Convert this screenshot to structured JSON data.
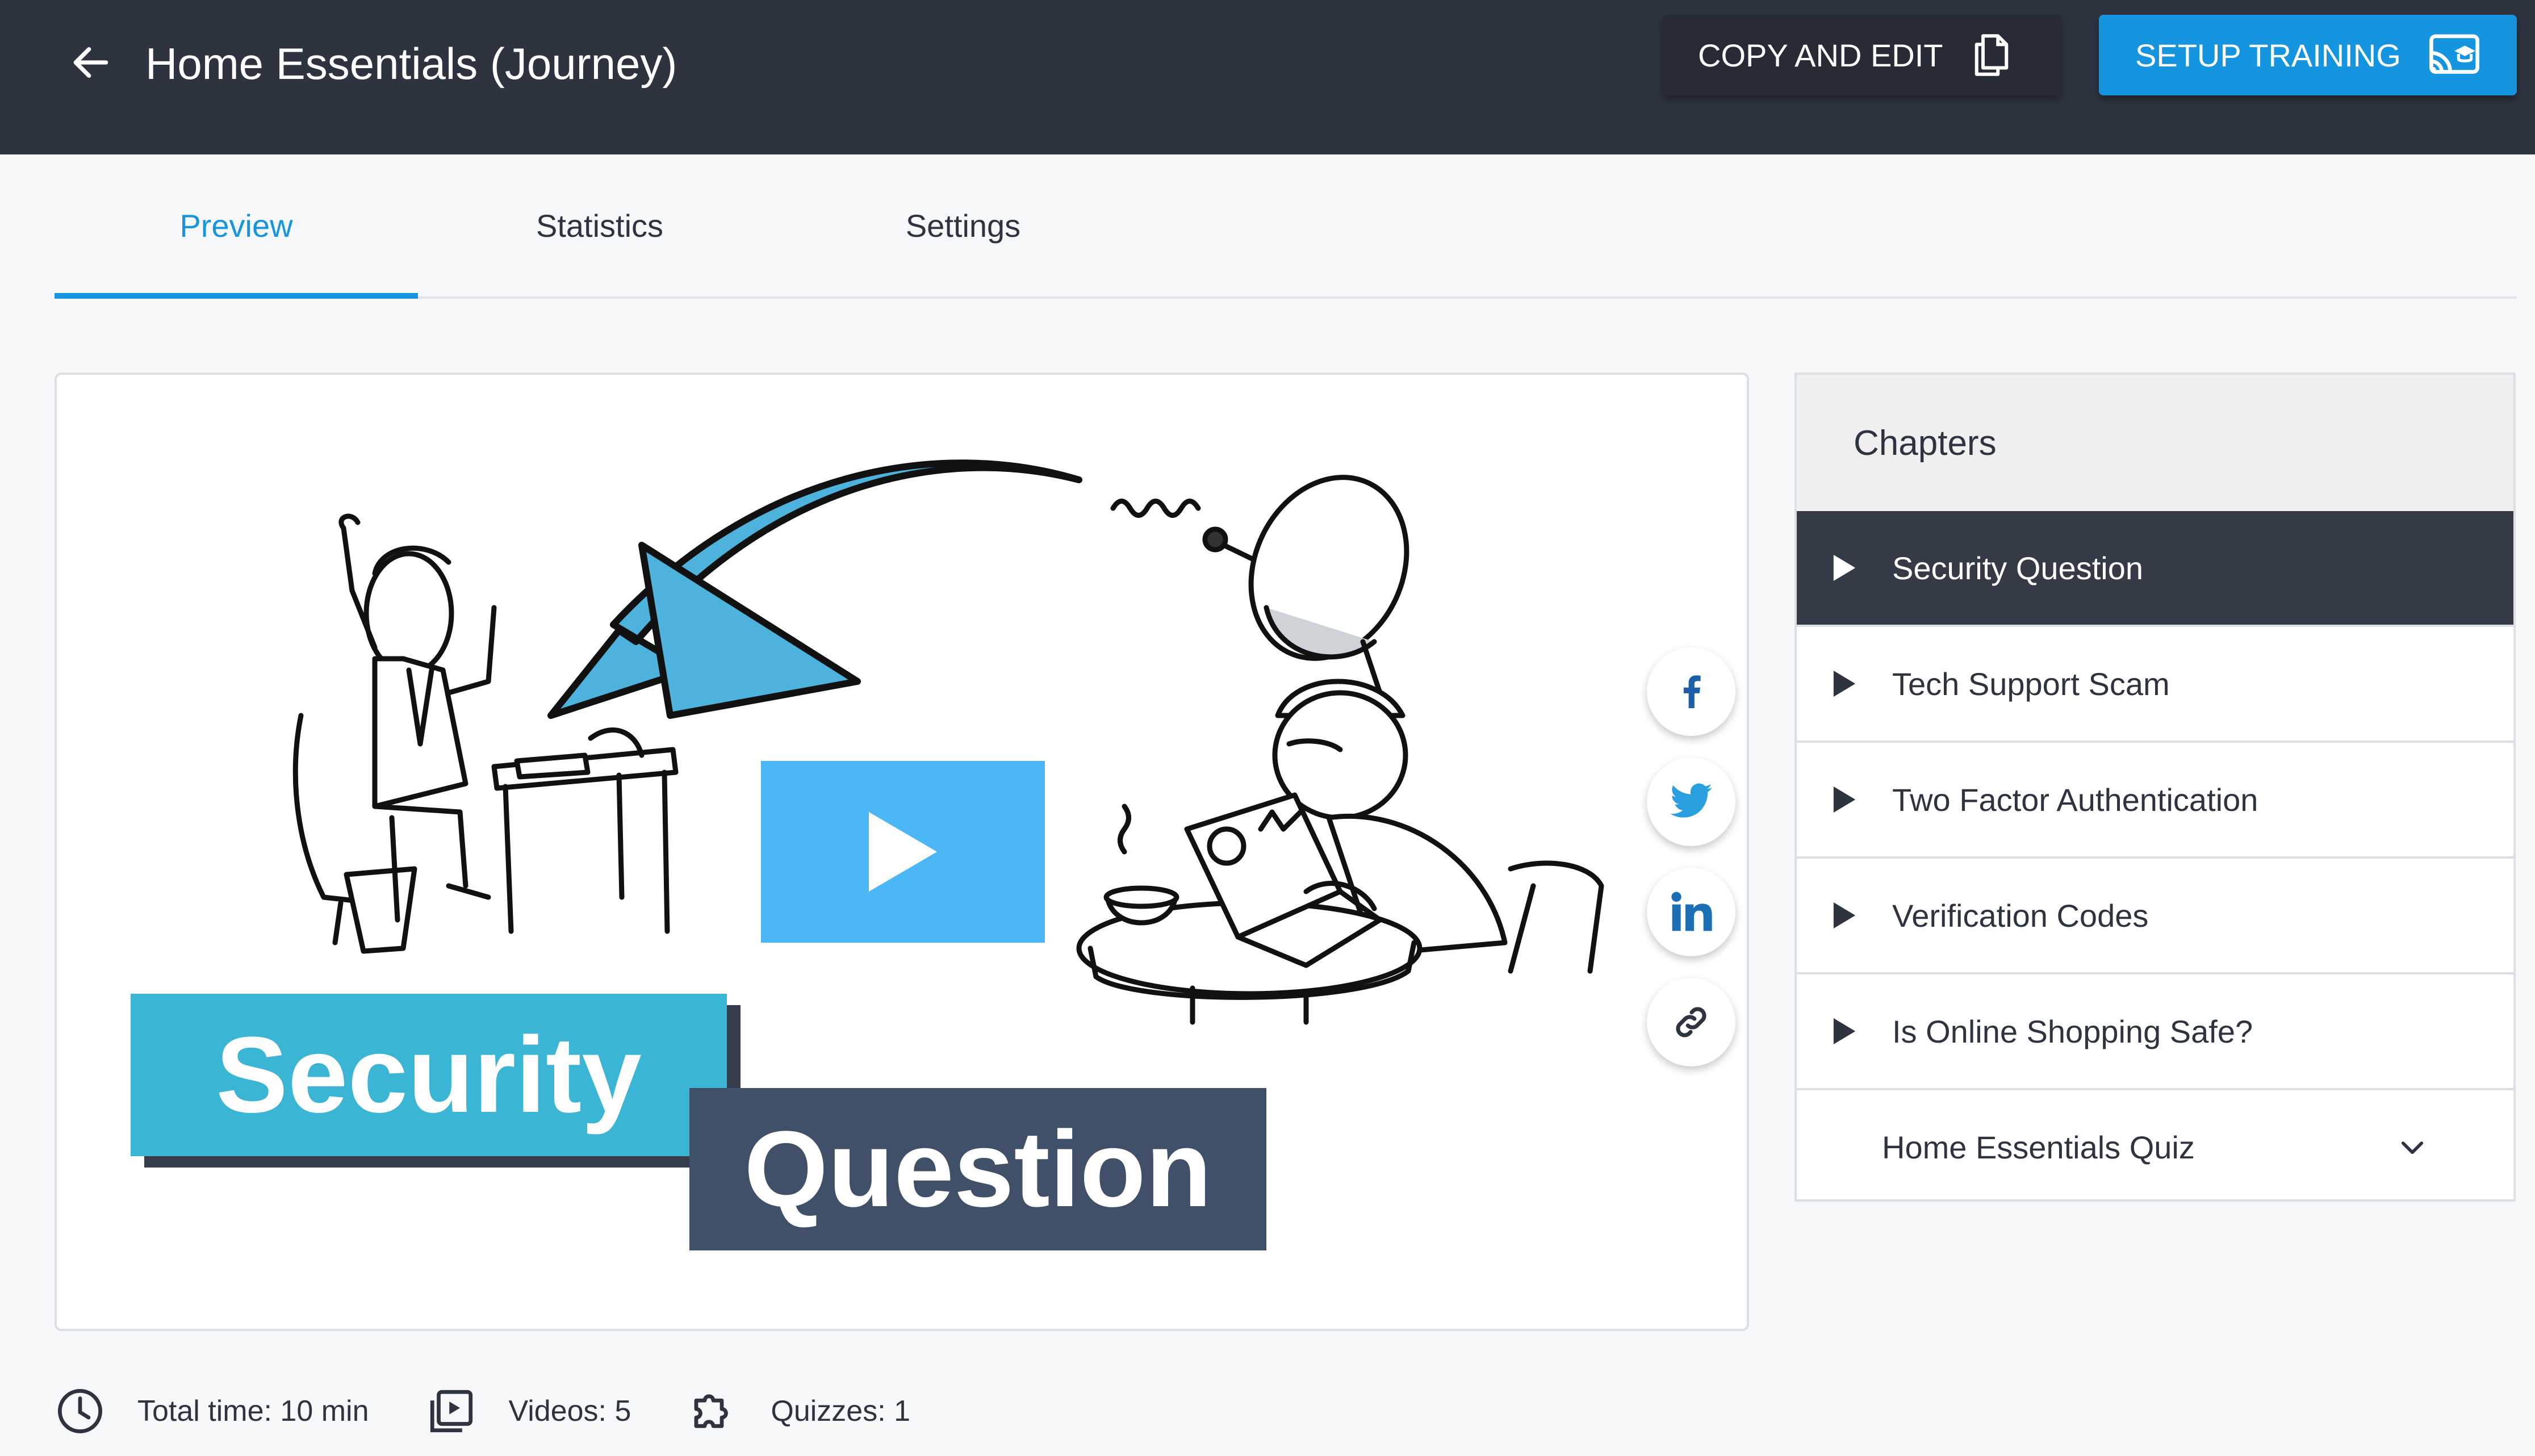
{
  "header": {
    "title": "Home Essentials (Journey)",
    "copy_label": "COPY AND EDIT",
    "setup_label": "SETUP TRAINING",
    "back_icon": "arrow-left-icon",
    "copy_icon": "copy-icon",
    "setup_icon": "cast-training-icon"
  },
  "tabs": [
    {
      "label": "Preview",
      "active": true
    },
    {
      "label": "Statistics",
      "active": false
    },
    {
      "label": "Settings",
      "active": false
    }
  ],
  "preview": {
    "title_line1": "Security",
    "title_line2": "Question",
    "play_icon": "play-icon",
    "share_icons": [
      "facebook-icon",
      "twitter-icon",
      "linkedin-icon",
      "link-icon"
    ]
  },
  "chapters": {
    "header": "Chapters",
    "items": [
      {
        "label": "Security Question",
        "active": true
      },
      {
        "label": "Tech Support Scam",
        "active": false
      },
      {
        "label": "Two Factor Authentication",
        "active": false
      },
      {
        "label": "Verification Codes",
        "active": false
      },
      {
        "label": "Is Online Shopping Safe?",
        "active": false
      }
    ],
    "quiz": {
      "label": "Home Essentials Quiz",
      "icon": "chevron-down-icon"
    }
  },
  "stats": {
    "total_time": "Total time: 10 min",
    "videos": "Videos: 5",
    "quizzes": "Quizzes: 1"
  },
  "colors": {
    "topbar": "#2e3340",
    "accent": "#1595e0",
    "play": "#4bb8f5",
    "title_box1": "#3ab5d3",
    "title_box2": "#3f5068",
    "chapter_active": "#353a47"
  }
}
